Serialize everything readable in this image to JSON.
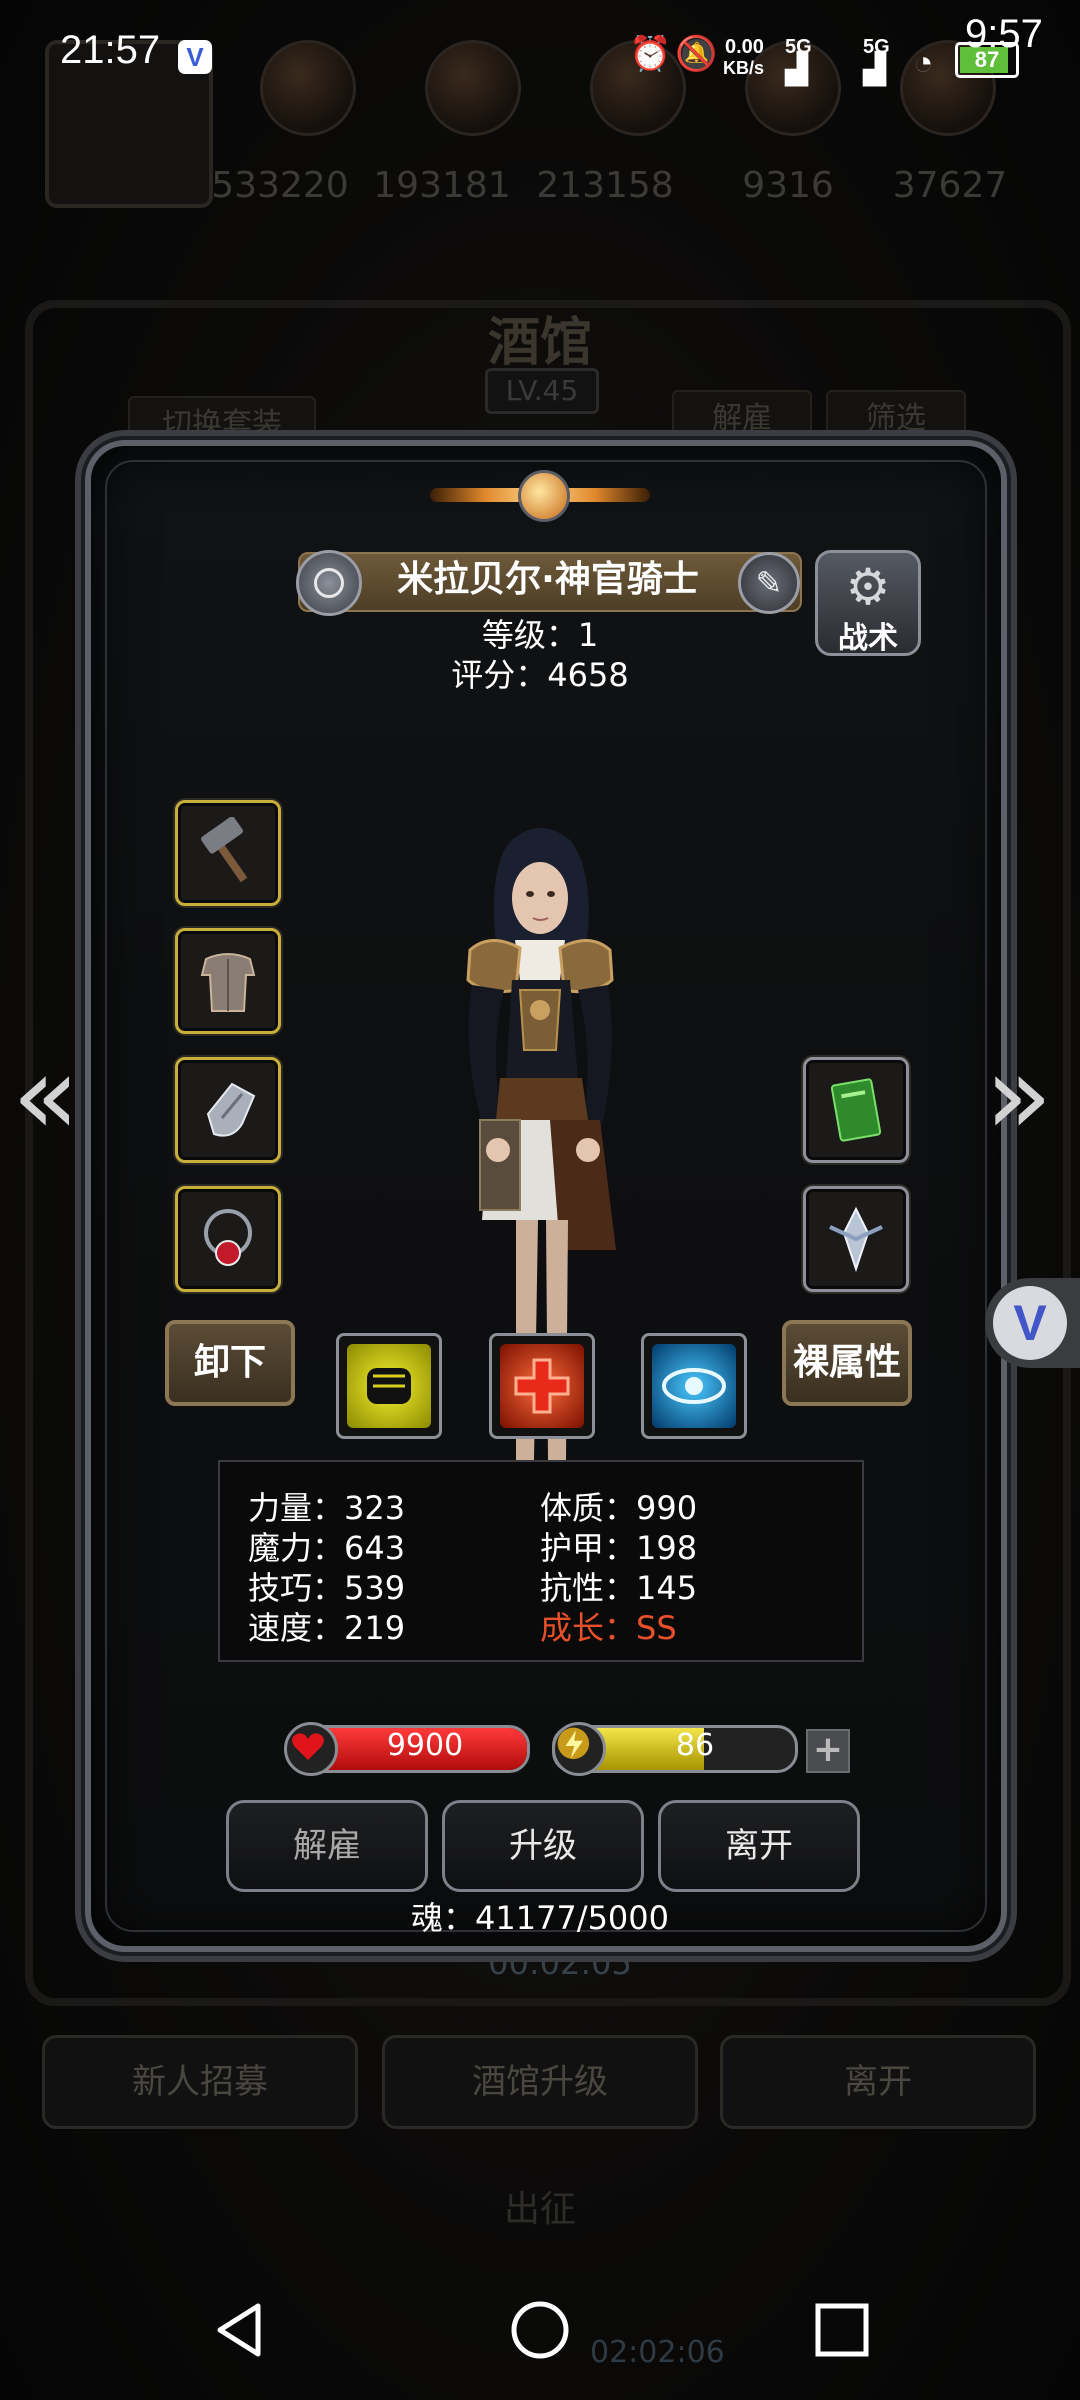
{
  "status_bar": {
    "time": "21:57",
    "time_right": "9:57",
    "net_speed_value": "0.00",
    "net_speed_unit": "KB/s",
    "signal_1": "5G",
    "signal_2": "5G",
    "battery": "87"
  },
  "background": {
    "resources": [
      "533220",
      "193181",
      "213158",
      "9316",
      "37627"
    ],
    "title": "酒馆",
    "level": "LV.45",
    "switch_outfit": "切换套装",
    "dismiss": "解雇",
    "filter": "筛选",
    "timer": "00:02:05",
    "buttons": [
      "新人招募",
      "酒馆升级",
      "离开"
    ],
    "sortie": "出征",
    "timer2": "02:02:06"
  },
  "hero": {
    "name": "米拉贝尔·神官骑士",
    "level_label": "等级：1",
    "score_label": "评分：4658",
    "tactics": "战术",
    "unequip": "卸下",
    "base_stats": "裸属性",
    "stats": [
      {
        "label": "力量：323"
      },
      {
        "label": "魔力：643"
      },
      {
        "label": "技巧：539"
      },
      {
        "label": "速度：219"
      },
      {
        "label": "体质：990"
      },
      {
        "label": "护甲：198"
      },
      {
        "label": "抗性：145"
      },
      {
        "label": "成长：SS",
        "color": "#e8502a"
      }
    ],
    "hp": "9900",
    "energy": "86",
    "energy_fraction": 0.62,
    "actions": [
      "解雇",
      "升级",
      "离开"
    ],
    "soul": "魂：41177/5000"
  },
  "icons": {
    "equipment": [
      "hammer-icon",
      "armor-icon",
      "gauntlet-icon",
      "amulet-icon"
    ],
    "accessories": [
      "spellbook-icon",
      "crest-icon"
    ],
    "skills": [
      "fist-icon",
      "heal-cross-icon",
      "eye-icon"
    ]
  },
  "colors": {
    "hp": "#d11a1a",
    "energy": "#d8c21a",
    "gold_frame": "#c8ae3a",
    "growth": "#e8502a"
  }
}
